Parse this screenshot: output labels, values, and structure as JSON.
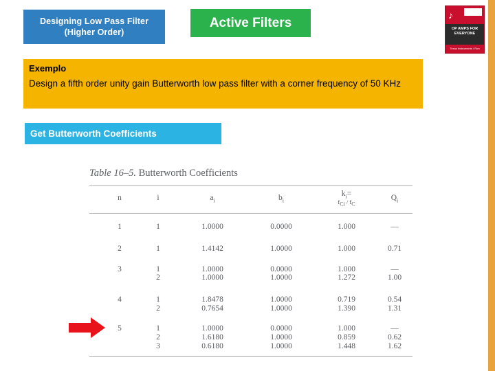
{
  "slide": {
    "title_chip": {
      "line1": "Designing Low Pass Filter",
      "line2": "(Higher Order)"
    },
    "header_chip": {
      "label": "Active Filters"
    },
    "book_thumb": {
      "glyph": "♪",
      "mid_text": "OP AMPS FOR EVERYONE",
      "bottom_text": "Texas Instruments / Ron Mancini"
    },
    "exemplo": {
      "label": "Exemplo",
      "body": "Design a fifth order unity gain  Butterworth low pass filter with a corner frequency of 50 KHz"
    },
    "action_bar": {
      "label": "Get Butterworth Coefficients"
    },
    "table": {
      "caption_number": "Table 16–5.",
      "caption_text": "Butterworth Coefficients",
      "headers": {
        "n": "n",
        "i": "i",
        "a": "a",
        "a_sub": "i",
        "b": "b",
        "b_sub": "i",
        "k": "k",
        "k_sub": "i",
        "k_eq": "=",
        "k_frac_num": "f",
        "k_frac_num_sub": "Ci",
        "k_frac_den": "f",
        "k_frac_den_sub": "C",
        "Q": "Q",
        "Q_sub": "i"
      },
      "rows": [
        {
          "n": "1",
          "entries": [
            {
              "i": "1",
              "a": "1.0000",
              "b": "0.0000",
              "k": "1.000",
              "Q": "—"
            }
          ]
        },
        {
          "n": "2",
          "entries": [
            {
              "i": "1",
              "a": "1.4142",
              "b": "1.0000",
              "k": "1.000",
              "Q": "0.71"
            }
          ]
        },
        {
          "n": "3",
          "entries": [
            {
              "i": "1",
              "a": "1.0000",
              "b": "0.0000",
              "k": "1.000",
              "Q": "—"
            },
            {
              "i": "2",
              "a": "1.0000",
              "b": "1.0000",
              "k": "1.272",
              "Q": "1.00"
            }
          ]
        },
        {
          "n": "4",
          "entries": [
            {
              "i": "1",
              "a": "1.8478",
              "b": "1.0000",
              "k": "0.719",
              "Q": "0.54"
            },
            {
              "i": "2",
              "a": "0.7654",
              "b": "1.0000",
              "k": "1.390",
              "Q": "1.31"
            }
          ]
        },
        {
          "n": "5",
          "entries": [
            {
              "i": "1",
              "a": "1.0000",
              "b": "0.0000",
              "k": "1.000",
              "Q": "—"
            },
            {
              "i": "2",
              "a": "1.6180",
              "b": "1.0000",
              "k": "0.859",
              "Q": "0.62"
            },
            {
              "i": "3",
              "a": "0.6180",
              "b": "1.0000",
              "k": "1.448",
              "Q": "1.62"
            }
          ]
        }
      ]
    },
    "colors": {
      "title_chip": "#2f7fc1",
      "header_chip": "#2bb24c",
      "exemplo_band": "#f5b400",
      "action_bar": "#2bb3e3",
      "right_bar": "#e8a33d",
      "arrow": "#e8131a"
    }
  }
}
